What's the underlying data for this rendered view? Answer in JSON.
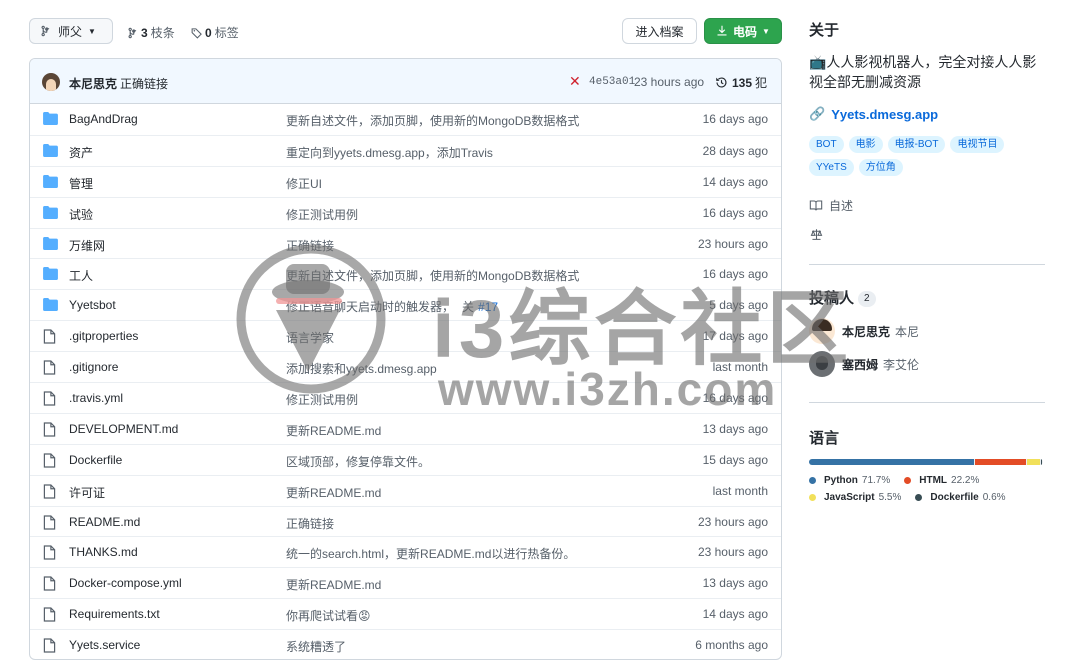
{
  "toolbar": {
    "branch": "师父",
    "branches_count": "3",
    "branches_label": "枝条",
    "tags_count": "0",
    "tags_label": "标签",
    "goto_file": "进入档案",
    "code": "电码"
  },
  "commit": {
    "author": "本尼思克",
    "message": "正确链接",
    "sha": "4e53a01",
    "time": "23 hours ago",
    "count": "135",
    "count_label": "犯"
  },
  "files": [
    {
      "type": "dir",
      "name": "BagAndDrag",
      "message": "更新自述文件，添加页脚，使用新的MongoDB数据格式",
      "time": "16 days ago"
    },
    {
      "type": "dir",
      "name": "资产",
      "message": "重定向到yyets.dmesg.app，添加Travis",
      "time": "28 days ago"
    },
    {
      "type": "dir",
      "name": "管理",
      "message": "修正UI",
      "time": "14 days ago"
    },
    {
      "type": "dir",
      "name": "试验",
      "message": "修正测试用例",
      "time": "16 days ago"
    },
    {
      "type": "dir",
      "name": "万维网",
      "message": "正确链接",
      "time": "23 hours ago"
    },
    {
      "type": "dir",
      "name": "工人",
      "message": "更新自述文件，添加页脚，使用新的MongoDB数据格式",
      "time": "16 days ago"
    },
    {
      "type": "dir",
      "name": "Yyetsbot",
      "message": "修正语音聊天启动时的触发器，",
      "issue_label": "关",
      "issue": "#17",
      "time": "5 days ago"
    },
    {
      "type": "file",
      "name": ".gitproperties",
      "message": "语言学家",
      "time": "17 days ago"
    },
    {
      "type": "file",
      "name": ".gitignore",
      "message": "添加搜索和yyets.dmesg.app",
      "time": "last month"
    },
    {
      "type": "file",
      "name": ".travis.yml",
      "message": "修正测试用例",
      "time": "16 days ago"
    },
    {
      "type": "file",
      "name": "DEVELOPMENT.md",
      "message": "更新README.md",
      "time": "13 days ago"
    },
    {
      "type": "file",
      "name": "Dockerfile",
      "message": "区域顶部，修复停靠文件。",
      "time": "15 days ago"
    },
    {
      "type": "file",
      "name": "许可证",
      "message": "更新README.md",
      "time": "last month"
    },
    {
      "type": "file",
      "name": "README.md",
      "message": "正确链接",
      "time": "23 hours ago"
    },
    {
      "type": "file",
      "name": "THANKS.md",
      "message": "统一的search.html，更新README.md以进行热备份。",
      "time": "23 hours ago"
    },
    {
      "type": "file",
      "name": "Docker-compose.yml",
      "message": "更新README.md",
      "time": "13 days ago"
    },
    {
      "type": "file",
      "name": "Requirements.txt",
      "message": "你再爬试试看😡",
      "time": "14 days ago"
    },
    {
      "type": "file",
      "name": "Yyets.service",
      "message": "系统糟透了",
      "time": "6 months ago"
    }
  ],
  "about": {
    "title": "关于",
    "description": "📺人人影视机器人，完全对接人人影视全部无删减资源",
    "website": "Yyets.dmesg.app",
    "topics": [
      "BOT",
      "电影",
      "电报-BOT",
      "电视节目",
      "YYeTS",
      "方位角"
    ],
    "readme": "自述",
    "license_icon": "scale-icon"
  },
  "contributors": {
    "title": "投稿人",
    "count": "2",
    "list": [
      {
        "login": "本尼思克",
        "name": "本尼"
      },
      {
        "login": "塞西姆",
        "name": "李艾伦"
      }
    ]
  },
  "languages": {
    "title": "语言",
    "list": [
      {
        "name": "Python",
        "percent": "71.7%",
        "value": 71.7,
        "color": "#3572A5"
      },
      {
        "name": "HTML",
        "percent": "22.2%",
        "value": 22.2,
        "color": "#e34c26"
      },
      {
        "name": "JavaScript",
        "percent": "5.5%",
        "value": 5.5,
        "color": "#f1e05a"
      },
      {
        "name": "Dockerfile",
        "percent": "0.6%",
        "value": 0.6,
        "color": "#384d54"
      }
    ]
  },
  "watermark": {
    "text": "i3综合社区",
    "url": "www.i3zh.com"
  }
}
